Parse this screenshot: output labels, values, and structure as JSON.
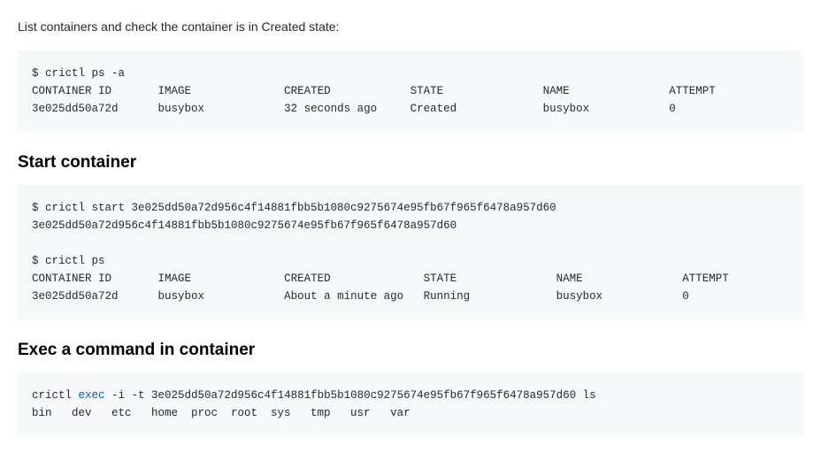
{
  "intro": "List containers and check the container is in Created state:",
  "block1": {
    "cmd": "$ crictl ps -a",
    "header_container_id": "CONTAINER ID",
    "header_image": "IMAGE",
    "header_created": "CREATED",
    "header_state": "STATE",
    "header_name": "NAME",
    "header_attempt": "ATTEMPT",
    "row_container_id": "3e025dd50a72d",
    "row_image": "busybox",
    "row_created": "32 seconds ago",
    "row_state": "Created",
    "row_name": "busybox",
    "row_attempt": "0"
  },
  "heading2": "Start container",
  "block2": {
    "cmd1": "$ crictl start 3e025dd50a72d956c4f14881fbb5b1080c9275674e95fb67f965f6478a957d60",
    "out1": "3e025dd50a72d956c4f14881fbb5b1080c9275674e95fb67f965f6478a957d60",
    "cmd2": "$ crictl ps",
    "header_container_id": "CONTAINER ID",
    "header_image": "IMAGE",
    "header_created": "CREATED",
    "header_state": "STATE",
    "header_name": "NAME",
    "header_attempt": "ATTEMPT",
    "row_container_id": "3e025dd50a72d",
    "row_image": "busybox",
    "row_created": "About a minute ago",
    "row_state": "Running",
    "row_name": "busybox",
    "row_attempt": "0"
  },
  "heading3": "Exec a command in container",
  "block3": {
    "pre": "crictl ",
    "hl": "exec",
    "post": " -i -t 3e025dd50a72d956c4f14881fbb5b1080c9275674e95fb67f965f6478a957d60 ls",
    "out": "bin   dev   etc   home  proc  root  sys   tmp   usr   var"
  }
}
